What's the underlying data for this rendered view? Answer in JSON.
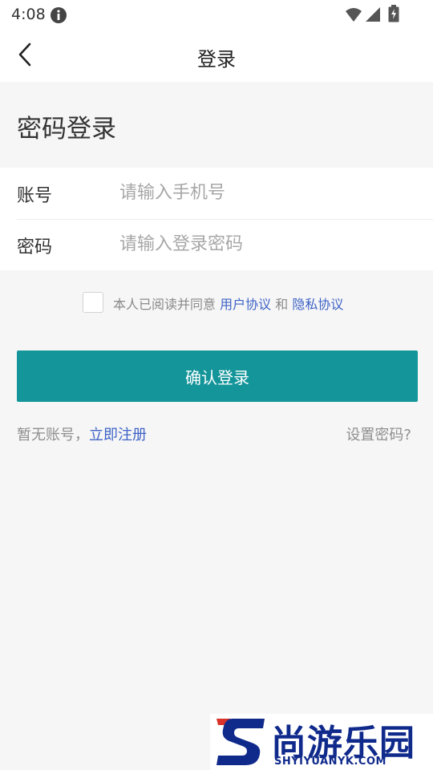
{
  "status_bar": {
    "time": "4:08",
    "icons": [
      "info-icon",
      "wifi-icon",
      "signal-icon",
      "battery-icon"
    ]
  },
  "header": {
    "back_icon": "chevron-left-icon",
    "title": "登录"
  },
  "section_title": "密码登录",
  "form": {
    "account_label": "账号",
    "account_placeholder": "请输入手机号",
    "account_value": "",
    "password_label": "密码",
    "password_placeholder": "请输入登录密码",
    "password_value": ""
  },
  "agreement": {
    "checked": false,
    "prefix": "本人已阅读并同意",
    "user_agreement": "用户协议",
    "conjunction": "和",
    "privacy_policy": "隐私协议"
  },
  "login_button": "确认登录",
  "register": {
    "prefix": "暂无账号，",
    "link": "立即注册"
  },
  "set_password": "设置密码?",
  "watermark": {
    "name": "尚游乐园",
    "url": "SHYIYUANYK.COM"
  },
  "colors": {
    "primary": "#13959a",
    "link": "#3e63c7",
    "background": "#f6f6f6",
    "watermark": "#102a8c"
  }
}
